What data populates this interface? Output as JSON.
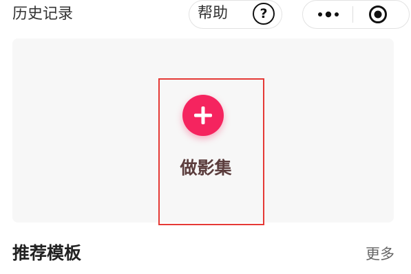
{
  "header": {
    "title": "历史记录",
    "help_label": "帮助",
    "help_icon_glyph": "?",
    "icons": [
      "help-icon",
      "more-icon",
      "close-icon"
    ]
  },
  "create_card": {
    "label": "做影集",
    "accent_color": "#f5245f",
    "highlight_color": "#e53935"
  },
  "templates_section": {
    "title": "推荐模板",
    "more_label": "更多"
  }
}
